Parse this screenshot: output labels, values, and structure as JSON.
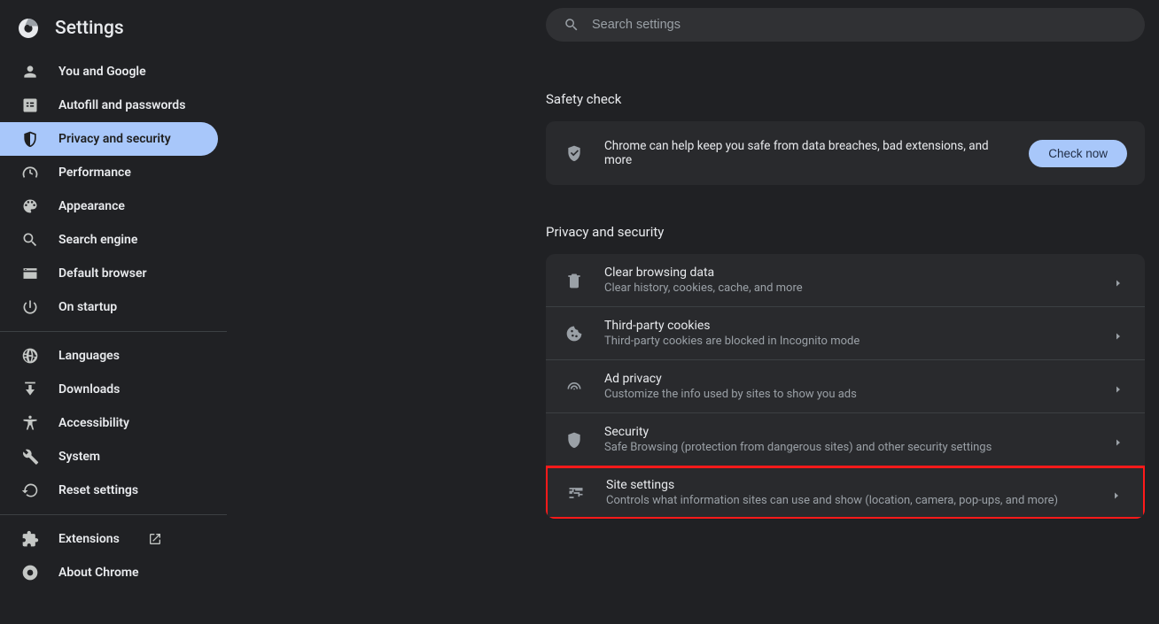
{
  "app_title": "Settings",
  "search": {
    "placeholder": "Search settings"
  },
  "sidebar": {
    "items": [
      {
        "label": "You and Google",
        "icon": "person-icon"
      },
      {
        "label": "Autofill and passwords",
        "icon": "autofill-icon"
      },
      {
        "label": "Privacy and security",
        "icon": "shield-icon",
        "active": true
      },
      {
        "label": "Performance",
        "icon": "speedometer-icon"
      },
      {
        "label": "Appearance",
        "icon": "palette-icon"
      },
      {
        "label": "Search engine",
        "icon": "search-icon"
      },
      {
        "label": "Default browser",
        "icon": "browser-icon"
      },
      {
        "label": "On startup",
        "icon": "power-icon"
      }
    ],
    "items2": [
      {
        "label": "Languages",
        "icon": "globe-icon"
      },
      {
        "label": "Downloads",
        "icon": "download-icon"
      },
      {
        "label": "Accessibility",
        "icon": "accessibility-icon"
      },
      {
        "label": "System",
        "icon": "wrench-icon"
      },
      {
        "label": "Reset settings",
        "icon": "reset-icon"
      }
    ],
    "items3": [
      {
        "label": "Extensions",
        "icon": "extension-icon"
      },
      {
        "label": "About Chrome",
        "icon": "chrome-icon"
      }
    ]
  },
  "safety": {
    "heading": "Safety check",
    "text": "Chrome can help keep you safe from data breaches, bad extensions, and more",
    "button": "Check now"
  },
  "privacy": {
    "heading": "Privacy and security",
    "rows": [
      {
        "title": "Clear browsing data",
        "sub": "Clear history, cookies, cache, and more",
        "icon": "trash-icon"
      },
      {
        "title": "Third-party cookies",
        "sub": "Third-party cookies are blocked in Incognito mode",
        "icon": "cookie-icon"
      },
      {
        "title": "Ad privacy",
        "sub": "Customize the info used by sites to show you ads",
        "icon": "ad-icon"
      },
      {
        "title": "Security",
        "sub": "Safe Browsing (protection from dangerous sites) and other security settings",
        "icon": "security-icon"
      },
      {
        "title": "Site settings",
        "sub": "Controls what information sites can use and show (location, camera, pop-ups, and more)",
        "icon": "tune-icon",
        "highlighted": true
      }
    ]
  }
}
